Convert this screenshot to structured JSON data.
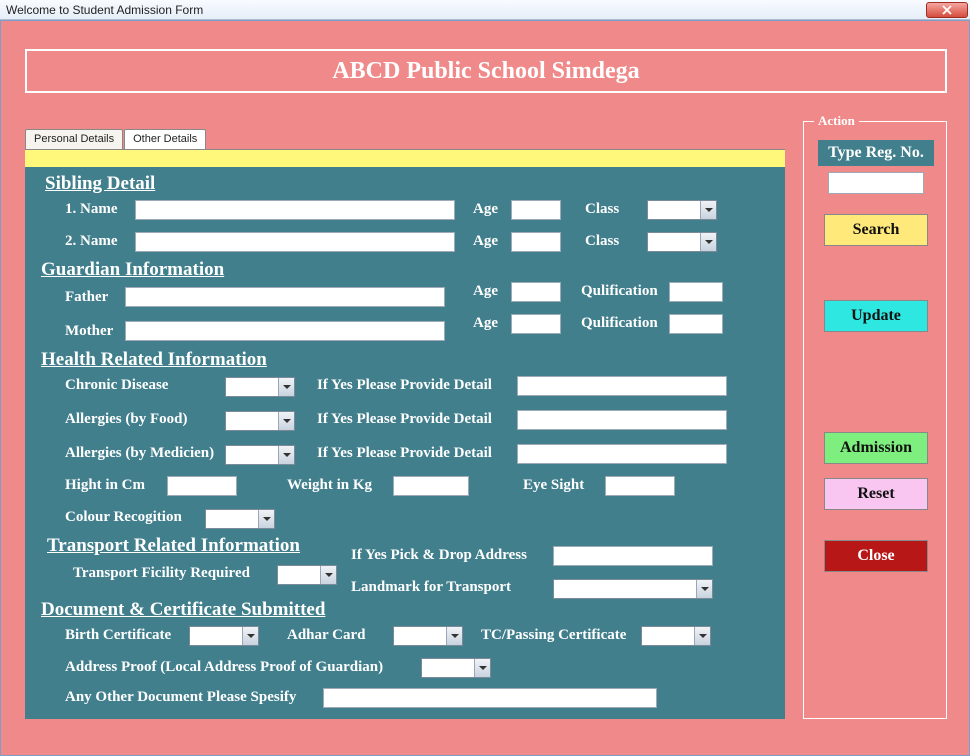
{
  "window": {
    "title": "Welcome to Student Admission Form"
  },
  "banner": "ABCD Public School Simdega",
  "tabs": {
    "personal": "Personal Details",
    "other": "Other Details"
  },
  "sections": {
    "sibling": {
      "heading": "Sibling Detail",
      "r1_name_label": "1. Name",
      "r1_age_label": "Age",
      "r1_class_label": "Class",
      "r2_name_label": "2. Name",
      "r2_age_label": "Age",
      "r2_class_label": "Class"
    },
    "guardian": {
      "heading": "Guardian Information",
      "father_label": "Father",
      "mother_label": "Mother",
      "age_label_1": "Age",
      "age_label_2": "Age",
      "qual_label_1": "Qulification",
      "qual_label_2": "Qulification"
    },
    "health": {
      "heading": "Health Related Information",
      "chronic_label": "Chronic Disease",
      "detail1_label": "If Yes Please Provide Detail",
      "alg_food_label": "Allergies (by Food)",
      "detail2_label": "If Yes Please Provide Detail",
      "alg_med_label": "Allergies (by Medicien)",
      "detail3_label": "If Yes Please Provide Detail",
      "height_label": "Hight in Cm",
      "weight_label": "Weight in Kg",
      "eye_label": "Eye Sight",
      "colour_label": "Colour Recogition"
    },
    "transport": {
      "heading": "Transport Related Information",
      "facility_label": "Transport Ficility Required",
      "pick_label": "If Yes Pick & Drop Address",
      "landmark_label": "Landmark for Transport"
    },
    "docs": {
      "heading": "Document & Certificate Submitted",
      "birth_label": "Birth Certificate",
      "adhar_label": "Adhar Card",
      "tc_label": "TC/Passing Certificate",
      "addr_label": "Address Proof (Local Address Proof of Guardian)",
      "other_label": "Any Other Document Please Spesify"
    }
  },
  "action": {
    "legend": "Action",
    "reg_label": "Type Reg. No.",
    "search": "Search",
    "update": "Update",
    "admission": "Admission",
    "reset": "Reset",
    "close": "Close"
  }
}
